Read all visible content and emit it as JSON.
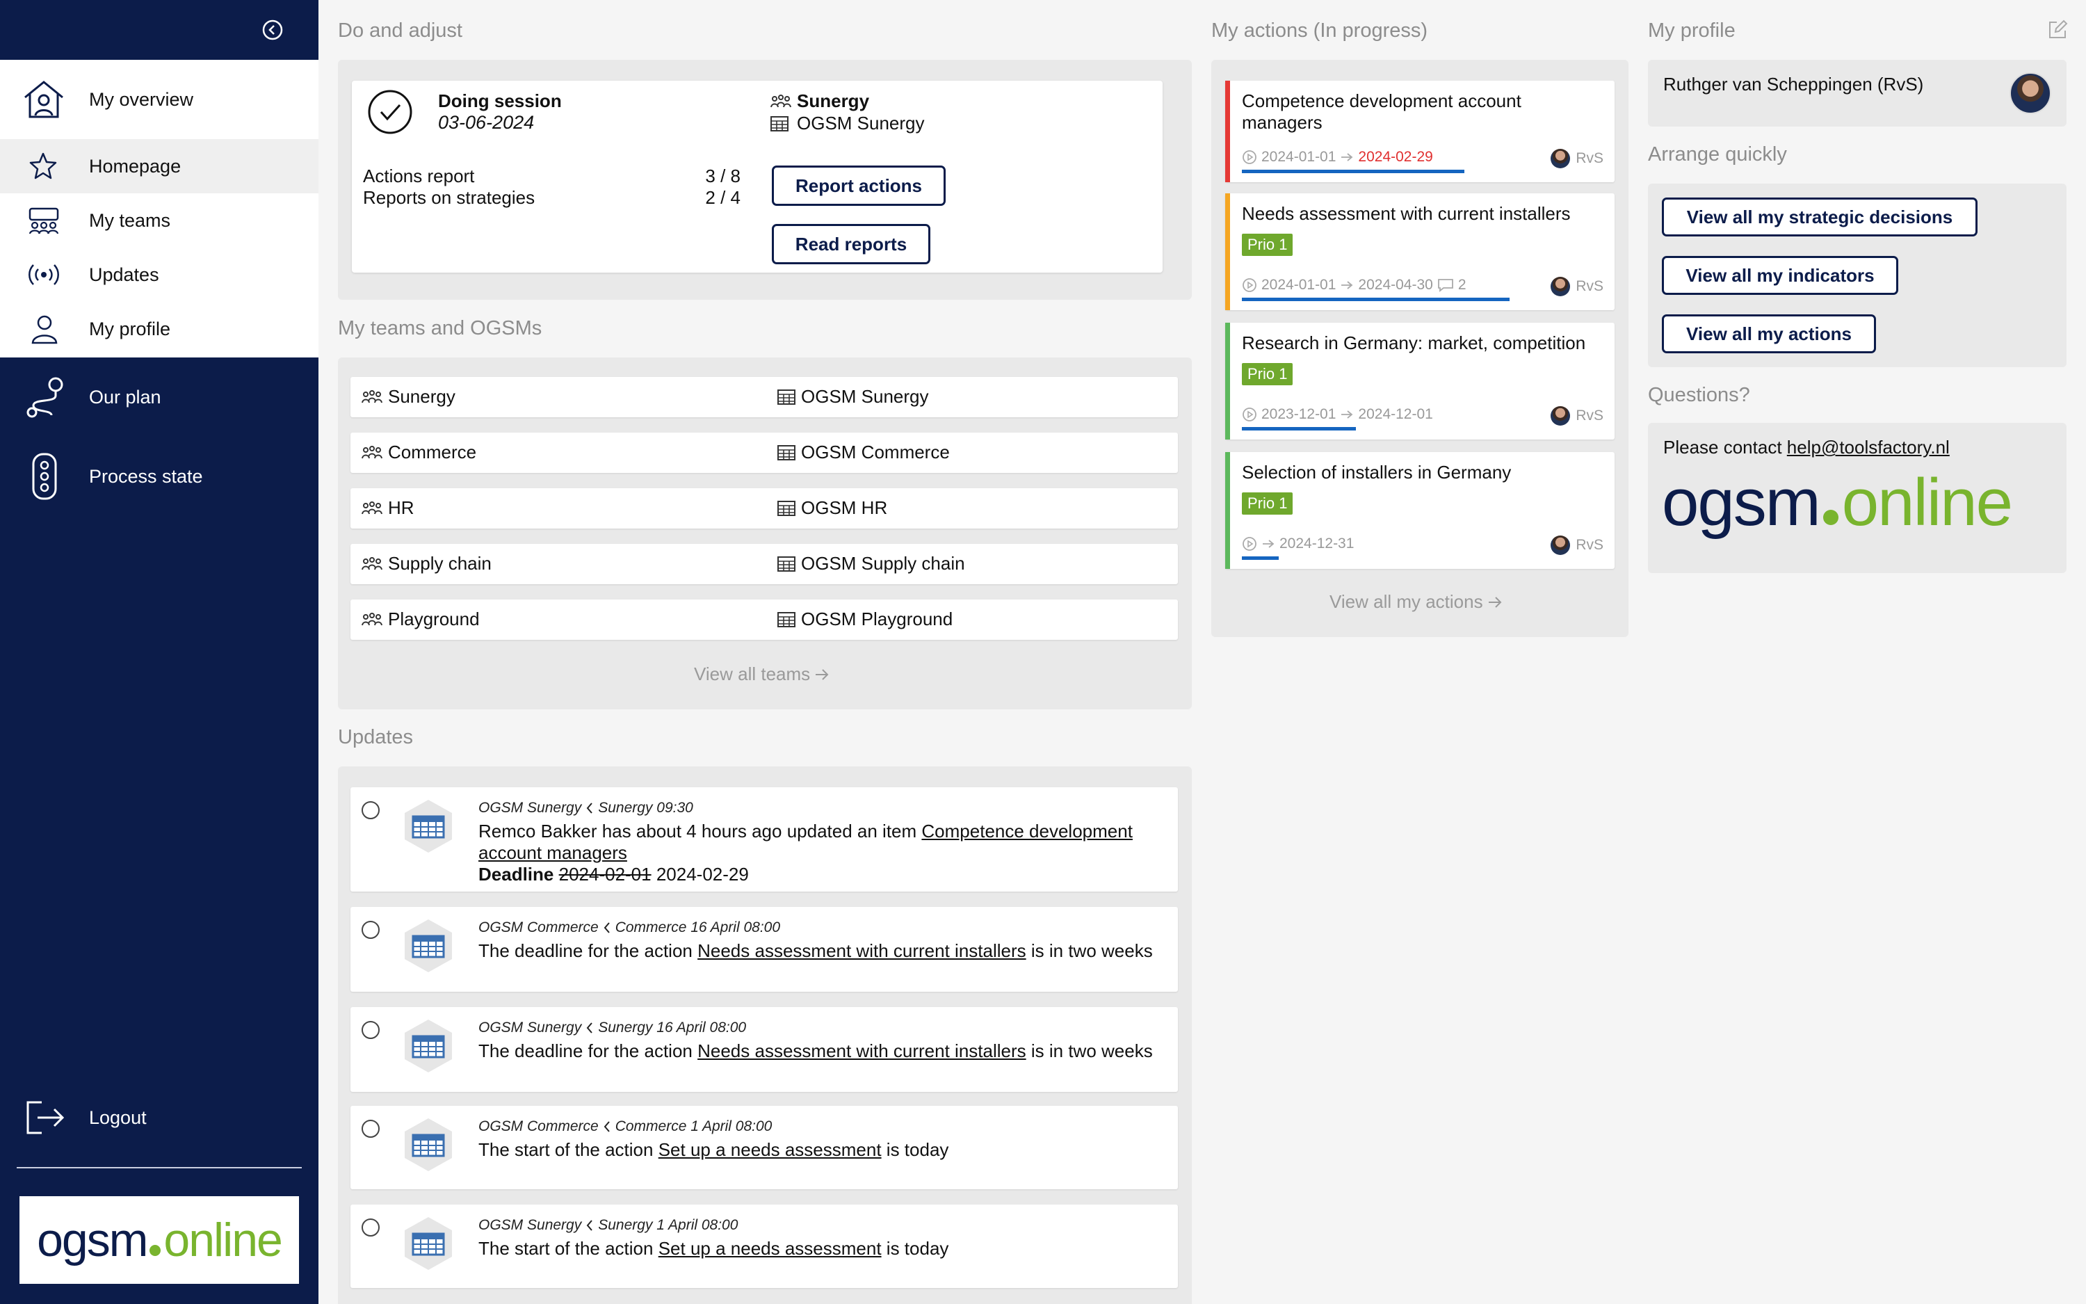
{
  "sidebar": {
    "nav_top": [
      {
        "label": "My overview",
        "icon": "house-user-icon"
      },
      {
        "label": "Homepage",
        "icon": "star-icon"
      },
      {
        "label": "My teams",
        "icon": "team-icon"
      },
      {
        "label": "Updates",
        "icon": "broadcast-icon"
      },
      {
        "label": "My profile",
        "icon": "user-icon"
      }
    ],
    "nav_dark": [
      {
        "label": "Our plan",
        "icon": "route-icon"
      },
      {
        "label": "Process state",
        "icon": "traffic-light-icon"
      }
    ],
    "logout": "Logout",
    "active_item": "Homepage"
  },
  "logo": {
    "part1": "ogsm",
    "part2": "online"
  },
  "do_adjust": {
    "title": "Do and adjust",
    "session_title": "Doing session",
    "session_date": "03-06-2024",
    "team": "Sunergy",
    "ogsm": "OGSM Sunergy",
    "rows": [
      {
        "label": "Actions report",
        "value": "3 / 8"
      },
      {
        "label": "Reports on strategies",
        "value": "2 / 4"
      }
    ],
    "btn_report_actions": "Report actions",
    "btn_read_reports": "Read reports"
  },
  "teams": {
    "title": "My teams and OGSMs",
    "rows": [
      {
        "team": "Sunergy",
        "ogsm": "OGSM Sunergy"
      },
      {
        "team": "Commerce",
        "ogsm": "OGSM Commerce"
      },
      {
        "team": "HR",
        "ogsm": "OGSM HR"
      },
      {
        "team": "Supply chain",
        "ogsm": "OGSM Supply chain"
      },
      {
        "team": "Playground",
        "ogsm": "OGSM Playground"
      }
    ],
    "view_all": "View all teams"
  },
  "updates": {
    "title": "Updates",
    "items": [
      {
        "ogsm": "OGSM Sunergy",
        "team": "Sunergy 09:30",
        "pre": "Remco Bakker has about 4 hours ago updated an item ",
        "link": "Competence development account managers",
        "post": "",
        "deadline_label": "Deadline",
        "deadline_old": "2024-02-01",
        "deadline_new": "2024-02-29"
      },
      {
        "ogsm": "OGSM Commerce",
        "team": "Commerce 16 April 08:00",
        "pre": "The deadline for the action ",
        "link": "Needs assessment with current installers",
        "post": " is in two weeks"
      },
      {
        "ogsm": "OGSM Sunergy",
        "team": "Sunergy 16 April 08:00",
        "pre": "The deadline for the action ",
        "link": "Needs assessment with current installers",
        "post": " is in two weeks"
      },
      {
        "ogsm": "OGSM Commerce",
        "team": "Commerce 1 April 08:00",
        "pre": "The start of the action ",
        "link": "Set up a needs assessment",
        "post": " is today"
      },
      {
        "ogsm": "OGSM Sunergy",
        "team": "Sunergy 1 April 08:00",
        "pre": "The start of the action ",
        "link": "Set up a needs assessment",
        "post": " is today"
      }
    ]
  },
  "actions": {
    "title": "My actions (In progress)",
    "items": [
      {
        "title": "Competence development account managers",
        "prio": "",
        "start": "2024-01-01",
        "end": "2024-02-29",
        "comments": "",
        "owner": "RvS",
        "progress": 0.78,
        "status_color": "#e53935"
      },
      {
        "title": "Needs assessment with current installers",
        "prio": "Prio 1",
        "start": "2024-01-01",
        "end": "2024-04-30",
        "comments": "2",
        "owner": "RvS",
        "progress": 0.94,
        "status_color": "#f5a623"
      },
      {
        "title": "Research in Germany: market, competition",
        "prio": "Prio 1",
        "start": "2023-12-01",
        "end": "2024-12-01",
        "comments": "",
        "owner": "RvS",
        "progress": 0.4,
        "status_color": "#5cb85c"
      },
      {
        "title": "Selection of installers in Germany",
        "prio": "Prio 1",
        "start": "",
        "end": "2024-12-31",
        "comments": "",
        "owner": "RvS",
        "progress": 0.13,
        "status_color": "#5cb85c"
      }
    ],
    "view_all": "View all my actions"
  },
  "profile": {
    "title": "My profile",
    "name": "Ruthger van Scheppingen (RvS)"
  },
  "arrange": {
    "title": "Arrange quickly",
    "buttons": [
      "View all my strategic decisions",
      "View all my indicators",
      "View all my actions"
    ]
  },
  "questions": {
    "title": "Questions?",
    "text": "Please contact ",
    "email": "help@toolsfactory.nl"
  },
  "colors": {
    "navy": "#0c1c4a",
    "green": "#79b42e",
    "blue_progress": "#1565c0"
  }
}
